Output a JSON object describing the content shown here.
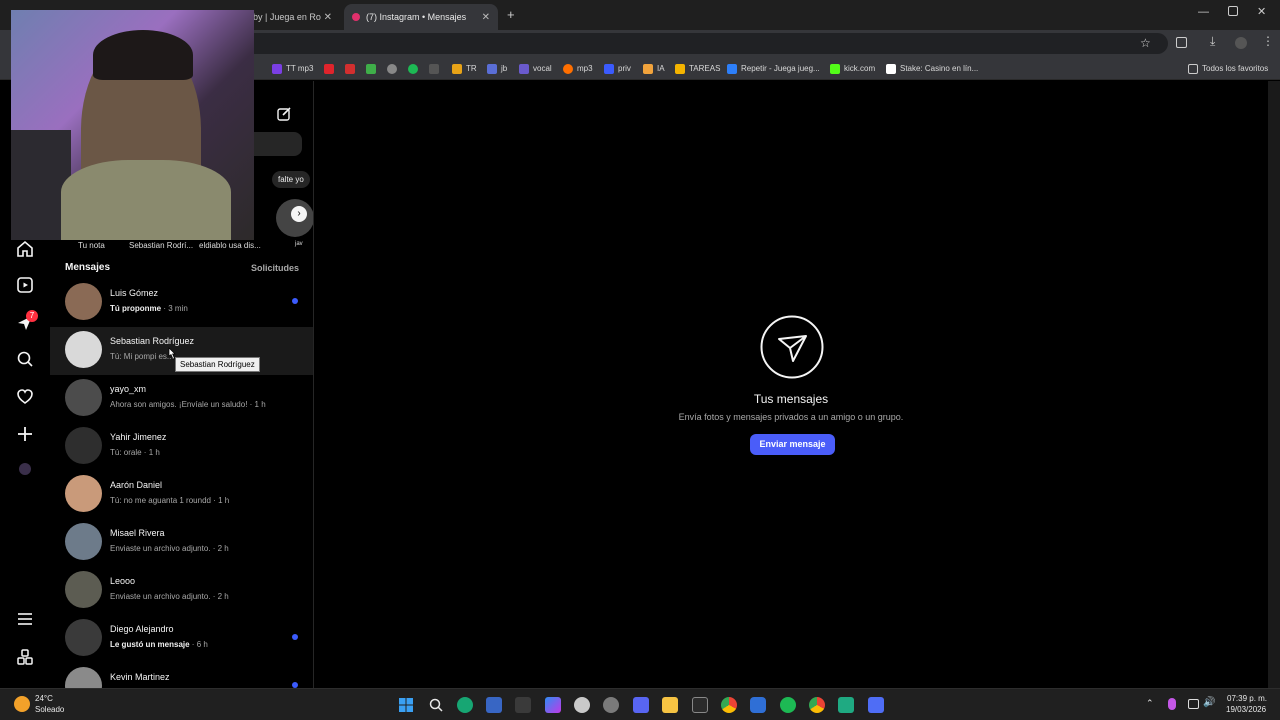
{
  "browser": {
    "tabs": [
      {
        "label": "bby | Juega en Ro"
      },
      {
        "label": "(7) Instagram • Mensajes"
      }
    ],
    "bookmarks": [
      {
        "label": "TT mp3",
        "color": "#7b3fe4"
      },
      {
        "label": "",
        "color": "#e0242c"
      },
      {
        "label": "",
        "color": "#d32f2f"
      },
      {
        "label": "",
        "color": "#3fae49"
      },
      {
        "label": "",
        "color": "#888888"
      },
      {
        "label": "",
        "color": "#1db954"
      },
      {
        "label": "",
        "color": "#444444"
      },
      {
        "label": "TR",
        "color": "#e8a317"
      },
      {
        "label": "jb",
        "color": "#5a6ed6"
      },
      {
        "label": "vocal",
        "color": "#6a5acd"
      },
      {
        "label": "mp3",
        "color": "#ff6f00"
      },
      {
        "label": "priv",
        "color": "#3b5bfd"
      },
      {
        "label": "IA",
        "color": "#f1a33c"
      },
      {
        "label": "TAREAS",
        "color": "#f4b400"
      },
      {
        "label": "Repetir - Juega jueg...",
        "color": "#2d7ff9"
      },
      {
        "label": "kick.com",
        "color": "#53fc18"
      },
      {
        "label": "Stake: Casino en lín...",
        "color": "#ffffff"
      }
    ],
    "all_favorites": "Todos los favoritos"
  },
  "notes": {
    "items": [
      {
        "label": "Tu nota"
      },
      {
        "label": "Sebastian Rodrí..."
      },
      {
        "label": "eldiablo usa dis..."
      },
      {
        "label": "jav"
      }
    ],
    "bubble": "falte yo"
  },
  "messages": {
    "title": "Mensajes",
    "requests": "Solicitudes",
    "tooltip": "Sebastian Rodríguez",
    "rows": [
      {
        "name": "Luis Gómez",
        "preview": "Tú proponme",
        "time": " · 3 min",
        "unread": true,
        "avatar_color": "#8a6a55"
      },
      {
        "name": "Sebastian Rodríguez",
        "preview": "Tú: Mi pompi es...",
        "time": "",
        "unread": false,
        "avatar_color": "#d9d9d9"
      },
      {
        "name": "yayo_xm",
        "preview": "Ahora son amigos. ¡Envíale un saludo!",
        "time": " · 1 h",
        "unread": false,
        "avatar_color": "#4c4c4c"
      },
      {
        "name": "Yahir Jimenez",
        "preview": "Tú: orale",
        "time": " · 1 h",
        "unread": false,
        "avatar_color": "#2e2e2e"
      },
      {
        "name": "Aarón Daniel",
        "preview": "Tú: no me aguanta 1 roundd",
        "time": " · 1 h",
        "unread": false,
        "avatar_color": "#c99a7a"
      },
      {
        "name": "Misael Rivera",
        "preview": "Enviaste un archivo adjunto.",
        "time": " · 2 h",
        "unread": false,
        "avatar_color": "#6d7b8a"
      },
      {
        "name": "Leooo",
        "preview": "Enviaste un archivo adjunto.",
        "time": " · 2 h",
        "unread": false,
        "avatar_color": "#5c5c52"
      },
      {
        "name": "Diego Alejandro",
        "preview": "Le gustó un mensaje",
        "time": " · 6 h",
        "unread": true,
        "avatar_color": "#3a3a3a"
      },
      {
        "name": "Kevin Martinez",
        "preview": "",
        "time": "",
        "unread": true,
        "avatar_color": "#8a8a8a"
      }
    ]
  },
  "nav": {
    "badge": "7"
  },
  "main": {
    "title": "Tus mensajes",
    "subtitle": "Envía fotos y mensajes privados a un amigo o un grupo.",
    "button": "Enviar mensaje",
    "accent": "#4a5df9"
  },
  "taskbar": {
    "temp": "24°C",
    "weather": "Soleado",
    "time": "07:39 p. m.",
    "date": "19/03/2026"
  }
}
